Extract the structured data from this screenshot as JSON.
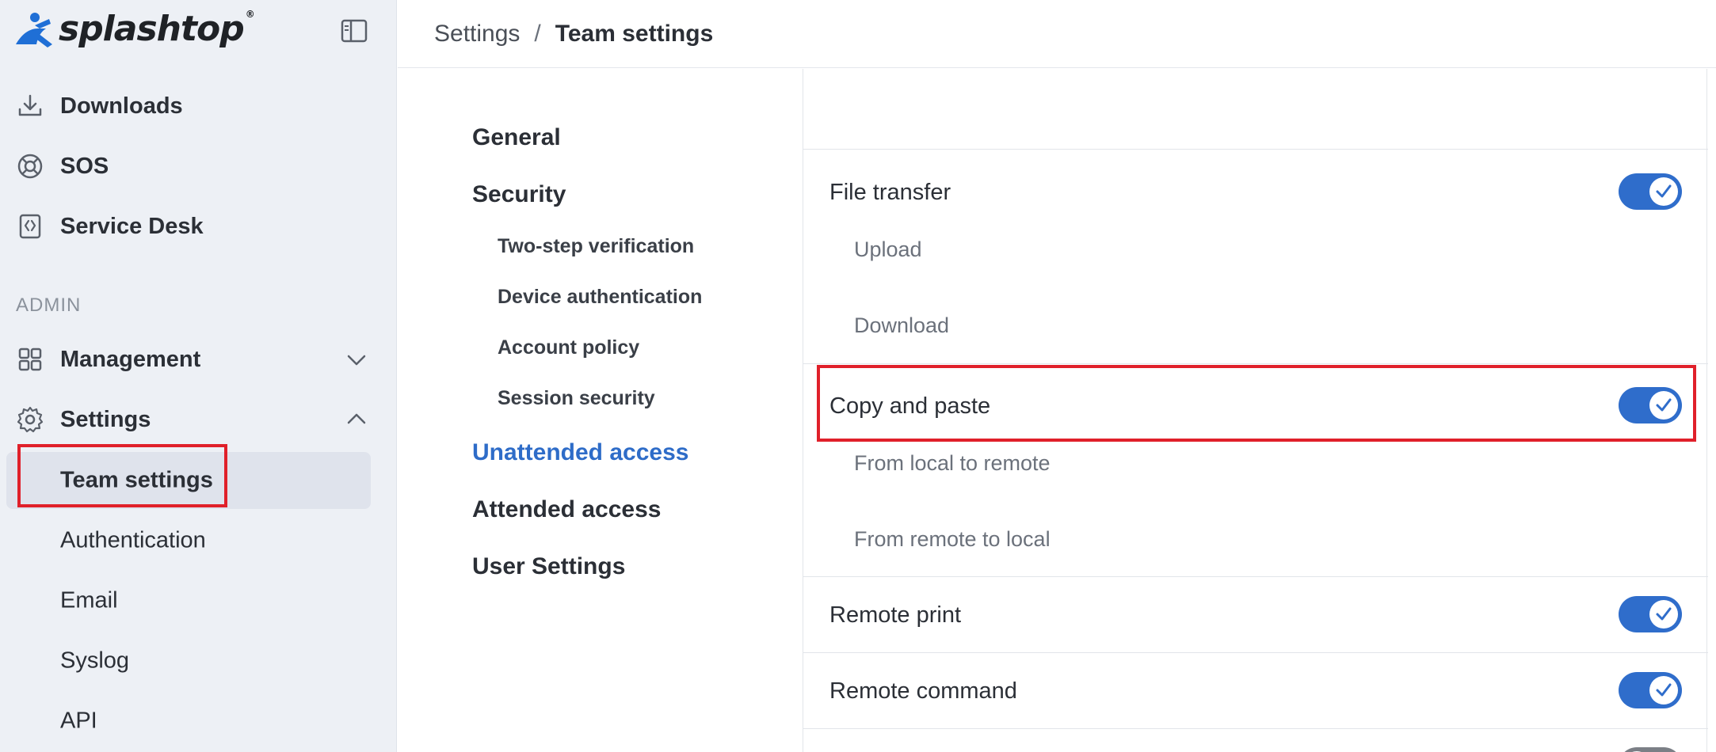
{
  "brand": {
    "name": "splashtop",
    "mark": "®"
  },
  "sidebar": {
    "main_items": [
      {
        "label": "Downloads",
        "icon": "download-icon"
      },
      {
        "label": "SOS",
        "icon": "sos-icon"
      },
      {
        "label": "Service Desk",
        "icon": "service-desk-icon"
      }
    ],
    "section_label": "ADMIN",
    "management": {
      "label": "Management",
      "icon": "grid-icon",
      "expanded": false
    },
    "settings": {
      "label": "Settings",
      "icon": "gear-icon",
      "expanded": true
    },
    "settings_items": [
      {
        "label": "Team settings",
        "active": true
      },
      {
        "label": "Authentication"
      },
      {
        "label": "Email"
      },
      {
        "label": "Syslog"
      },
      {
        "label": "API"
      }
    ]
  },
  "breadcrumb": {
    "parent": "Settings",
    "separator": "/",
    "current": "Team settings"
  },
  "subnav": {
    "items": [
      {
        "label": "General"
      },
      {
        "label": "Security"
      },
      {
        "label": "Two-step verification"
      },
      {
        "label": "Device authentication"
      },
      {
        "label": "Account policy"
      },
      {
        "label": "Session security"
      },
      {
        "label": "Unattended access",
        "active": true
      },
      {
        "label": "Attended access"
      },
      {
        "label": "User Settings"
      }
    ]
  },
  "content": {
    "rows": [
      {
        "title": "File transfer",
        "enabled": true,
        "sub": [
          "Upload",
          "Download"
        ]
      },
      {
        "title": "Copy and paste",
        "enabled": true,
        "sub": [
          "From local to remote",
          "From remote to local"
        ]
      },
      {
        "title": "Remote print",
        "enabled": true
      },
      {
        "title": "Remote command",
        "enabled": true
      }
    ]
  },
  "colors": {
    "accent": "#2f6dcb",
    "highlight": "#e0202a",
    "sidebar_bg": "#edf0f5",
    "active_bg": "#dfe3ec"
  }
}
